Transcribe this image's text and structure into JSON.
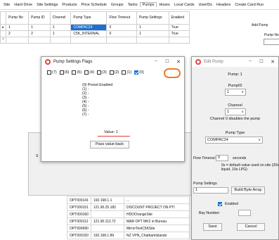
{
  "menubar": [
    "Site",
    "Hard Drive",
    "Site Settings",
    "Products",
    "Price Schedule",
    "Groups",
    "Tanks",
    "Pumps",
    "Hoses",
    "Local Cards",
    "UserIDs",
    "Headers",
    "Create Card Run"
  ],
  "pump_grid": {
    "headers": [
      "Pump No",
      "Pump ID",
      "Channel",
      "Pump Type",
      "Flow Timeout",
      "Pump Settings",
      "Enabled"
    ],
    "rows": [
      {
        "no": "1",
        "id": "1",
        "channel": "1",
        "type": "COMPAC24",
        "timeout": "0",
        "settings": "1",
        "enabled": "True"
      },
      {
        "no": "2",
        "id": "2",
        "channel": "1",
        "type": "C5K_INTERNAL",
        "timeout": "0",
        "settings": "1",
        "enabled": "True"
      }
    ],
    "new_row_marker": "*",
    "current_row_marker": "▸"
  },
  "add_pump": {
    "title": "Add Pump",
    "pump_no_label": "Pump No"
  },
  "background_window": {
    "label": "S"
  },
  "data_table": [
    [
      "OPT000141",
      "192.168.1.1",
      "..."
    ],
    [
      "OPT000151",
      "121.90.25.182",
      "DISCOUNT PROJECT ON PTI"
    ],
    [
      "OPT000160",
      "",
      "HDDChangeSite"
    ],
    [
      "OPT000112",
      "121.90.112.72",
      "MAR OPT MK2 in Bureau"
    ],
    [
      "OPT999990",
      "",
      "MirrorTestC5KSite"
    ],
    [
      "OPT000150",
      "192.168.1.89",
      "NZ VPN_ChathamIslands"
    ]
  ],
  "pump_settings_flags": {
    "title": "Pump Settings Flags",
    "flags": [
      {
        "label": "(7)",
        "checked": false
      },
      {
        "label": "(6)",
        "checked": false
      },
      {
        "label": "(5)",
        "checked": false
      },
      {
        "label": "(4)",
        "checked": false
      },
      {
        "label": "(3)",
        "checked": false
      },
      {
        "label": "(2)",
        "checked": false
      },
      {
        "label": "(1)",
        "checked": false
      },
      {
        "label": "(0)",
        "checked": true
      }
    ],
    "descriptions": [
      "(0) Preset Enabled",
      "(1) -",
      "(2) -",
      "(3) -",
      "(4) -",
      "(5) -",
      "(6) -",
      "(7) -"
    ],
    "value_text": "Value: 1",
    "pass_button": "Pass value back",
    "highlight_color": "#f07a2a"
  },
  "edit_pump": {
    "title": "Edit Pump",
    "pump_label": "Pump: 1",
    "pump_id_label": "PumpID",
    "pump_id_value": "1",
    "channel_label": "Channel",
    "channel_value": "1",
    "channel_note": "Channel 0 disables the pump",
    "pump_type_label": "Pump Type",
    "pump_type_value": "COMPAC24",
    "flow_timeout_label": "Flow Timeout:",
    "flow_timeout_value": "0",
    "seconds_label": "seconds",
    "timeout_note": "0s = default value used on site (20s liquid, 10s LPG)",
    "pump_settings_label": "Pump Settings",
    "pump_settings_value": "1",
    "build_button": "Build Byte Array",
    "enabled_label": "Enabled",
    "enabled_checked": true,
    "bay_number_label": "Bay Number:",
    "save_button": "Save",
    "cancel_button": "Cancel"
  },
  "colors": {
    "selection": "#1f6fd1",
    "checkbox": "#1a6fd6",
    "app_icon": "#e8453c",
    "underline": "#e23b3b"
  }
}
